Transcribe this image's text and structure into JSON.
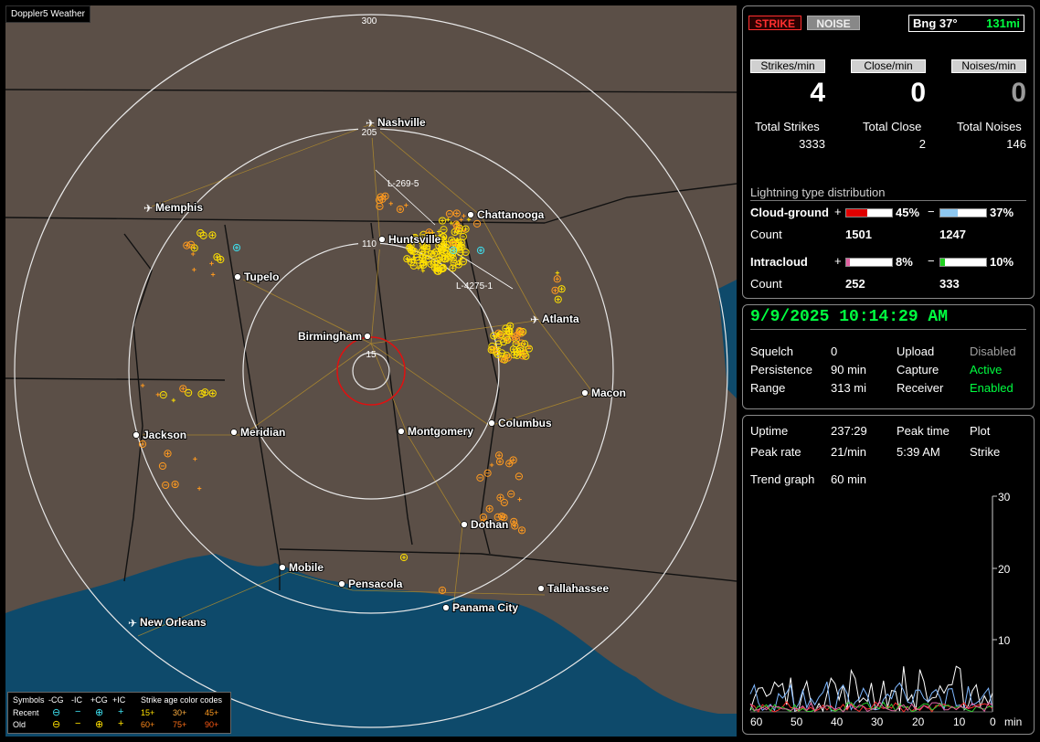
{
  "map": {
    "title": "Doppler5 Weather",
    "range_labels": [
      "300",
      "205",
      "110",
      "15"
    ],
    "track_labels": [
      "L-269-5",
      "L-4275-1"
    ],
    "cities": [
      {
        "name": "Nashville",
        "type": "airport"
      },
      {
        "name": "Memphis",
        "type": "airport"
      },
      {
        "name": "Chattanooga",
        "type": "dot"
      },
      {
        "name": "Huntsville",
        "type": "dot"
      },
      {
        "name": "Tupelo",
        "type": "dot"
      },
      {
        "name": "Atlanta",
        "type": "airport"
      },
      {
        "name": "Birmingham",
        "type": "dot"
      },
      {
        "name": "Macon",
        "type": "dot"
      },
      {
        "name": "Jackson",
        "type": "dot"
      },
      {
        "name": "Meridian",
        "type": "dot"
      },
      {
        "name": "Montgomery",
        "type": "dot"
      },
      {
        "name": "Columbus",
        "type": "dot"
      },
      {
        "name": "Dothan",
        "type": "dot"
      },
      {
        "name": "Mobile",
        "type": "dot"
      },
      {
        "name": "Pensacola",
        "type": "dot"
      },
      {
        "name": "Tallahassee",
        "type": "dot"
      },
      {
        "name": "Panama City",
        "type": "dot"
      },
      {
        "name": "New Orleans",
        "type": "airport"
      }
    ],
    "legend": {
      "symbols_label": "Symbols",
      "headers": [
        "-CG",
        "-IC",
        "+CG",
        "+IC"
      ],
      "recent_label": "Recent",
      "old_label": "Old",
      "age_title": "Strike age color codes",
      "recent_ages": [
        "15+",
        "30+",
        "45+"
      ],
      "old_ages": [
        "60+",
        "75+",
        "90+"
      ]
    }
  },
  "status": {
    "strike_button": "STRIKE",
    "noise_button": "NOISE",
    "bearing_label": "Bng 37°",
    "bearing_distance": "131mi",
    "strikes_per_min_label": "Strikes/min",
    "close_per_min_label": "Close/min",
    "noises_per_min_label": "Noises/min",
    "strikes_per_min": "4",
    "close_per_min": "0",
    "noises_per_min": "0",
    "total_strikes_label": "Total Strikes",
    "total_close_label": "Total Close",
    "total_noises_label": "Total Noises",
    "total_strikes": "3333",
    "total_close": "2",
    "total_noises": "146",
    "distribution_title": "Lightning type distribution",
    "cloud_ground_label": "Cloud-ground",
    "intracloud_label": "Intracloud",
    "count_label": "Count",
    "cg_pos_pct": "45%",
    "cg_neg_pct": "37%",
    "cg_pos_count": "1501",
    "cg_neg_count": "1247",
    "ic_pos_pct": "8%",
    "ic_neg_pct": "10%",
    "ic_pos_count": "252",
    "ic_neg_count": "333",
    "cg_pos_fill": 0.45,
    "cg_neg_fill": 0.37,
    "ic_pos_fill": 0.08,
    "ic_neg_fill": 0.1
  },
  "settings": {
    "datetime": "9/9/2025 10:14:29 AM",
    "squelch_label": "Squelch",
    "squelch": "0",
    "persistence_label": "Persistence",
    "persistence": "90 min",
    "range_label": "Range",
    "range": "313 mi",
    "upload_label": "Upload",
    "upload": "Disabled",
    "capture_label": "Capture",
    "capture": "Active",
    "receiver_label": "Receiver",
    "receiver": "Enabled"
  },
  "trend": {
    "uptime_label": "Uptime",
    "uptime": "237:29",
    "peak_time_label": "Peak time",
    "peak_time": "5:39 AM",
    "plot_label": "Plot",
    "plot": "Strike",
    "peak_rate_label": "Peak rate",
    "peak_rate": "21/min",
    "trend_graph_label": "Trend graph",
    "trend_graph": "60 min",
    "y_ticks": [
      "30",
      "20",
      "10"
    ],
    "x_ticks": [
      "60",
      "50",
      "40",
      "30",
      "20",
      "10",
      "0"
    ],
    "x_unit": "min"
  },
  "colors": {
    "land": "#5b4f47",
    "water": "#0e4a6b",
    "accent_green": "#00ff40",
    "strike_yellow": "#ffe000",
    "strike_orange": "#ff9a1f"
  }
}
